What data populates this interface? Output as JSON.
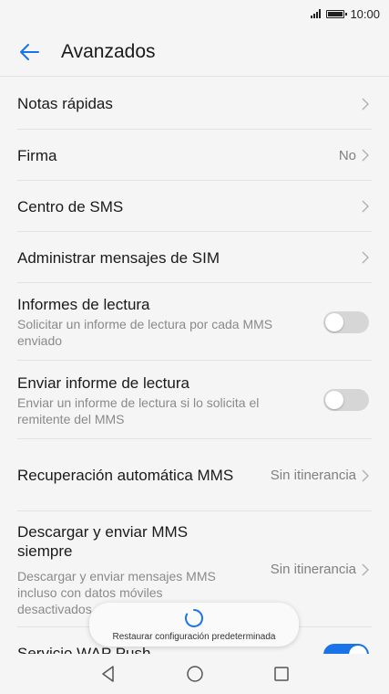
{
  "status": {
    "time": "10:00"
  },
  "header": {
    "title": "Avanzados"
  },
  "items": [
    {
      "title": "Notas rápidas"
    },
    {
      "title": "Firma",
      "value": "No"
    },
    {
      "title": "Centro de SMS"
    },
    {
      "title": "Administrar mensajes de SIM"
    },
    {
      "title": "Informes de lectura",
      "subtitle": "Solicitar un informe de lectura por cada MMS enviado",
      "toggle": false
    },
    {
      "title": "Enviar informe de lectura",
      "subtitle": "Enviar un informe de lectura si lo solicita el remitente del MMS",
      "toggle": false
    },
    {
      "title": "Recuperación automática MMS",
      "value": "Sin itinerancia"
    },
    {
      "title": "Descargar y enviar MMS siempre",
      "subtitle": "Descargar y enviar mensajes MMS incluso con datos móviles desactivados",
      "value": "Sin itinerancia"
    },
    {
      "title": "Servicio WAP Push",
      "toggle": true
    }
  ],
  "toast": {
    "text": "Restaurar configuración predeterminada"
  },
  "colors": {
    "accent": "#1a73e8",
    "toggle_off": "#d6d6d6",
    "background": "#f5f5f5"
  },
  "icons": {
    "back": "arrow-left-icon",
    "chevron": "chevron-right-icon",
    "spinner": "loading-spinner-icon",
    "nav": [
      "back-triangle-icon",
      "home-circle-icon",
      "recents-square-icon"
    ]
  }
}
